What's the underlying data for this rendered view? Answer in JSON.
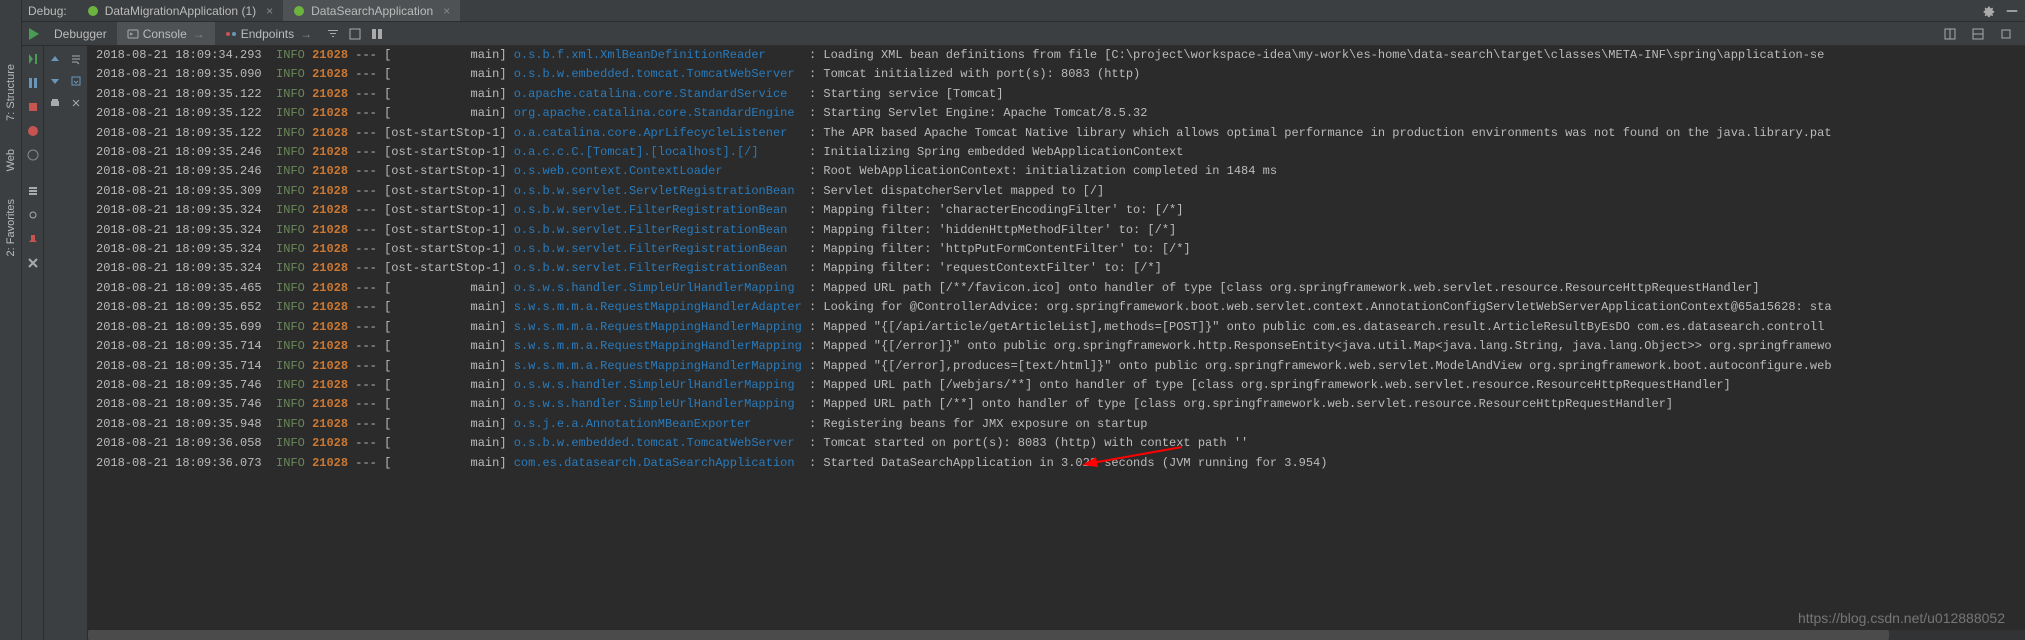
{
  "debug_label": "Debug:",
  "run_configs": [
    {
      "name": "DataMigrationApplication (1)",
      "active": false
    },
    {
      "name": "DataSearchApplication",
      "active": true
    }
  ],
  "tool_tabs": {
    "debugger": "Debugger",
    "console": "Console",
    "endpoints": "Endpoints"
  },
  "left_rail": {
    "structure": "7: Structure",
    "web": "Web",
    "favorites": "2: Favorites"
  },
  "watermark": "https://blog.csdn.net/u012888052",
  "log_columns": [
    "timestamp",
    "level",
    "pid",
    "marker",
    "thread",
    "logger",
    "message"
  ],
  "log_lines": [
    {
      "ts": "2018-08-21 18:09:34.293",
      "lvl": "INFO",
      "pid": "21028",
      "thr": "main",
      "logger": "o.s.b.f.xml.XmlBeanDefinitionReader",
      "msg": "Loading XML bean definitions from file [C:\\project\\workspace-idea\\my-work\\es-home\\data-search\\target\\classes\\META-INF\\spring\\application-se"
    },
    {
      "ts": "2018-08-21 18:09:35.090",
      "lvl": "INFO",
      "pid": "21028",
      "thr": "main",
      "logger": "o.s.b.w.embedded.tomcat.TomcatWebServer",
      "msg": "Tomcat initialized with port(s): 8083 (http)"
    },
    {
      "ts": "2018-08-21 18:09:35.122",
      "lvl": "INFO",
      "pid": "21028",
      "thr": "main",
      "logger": "o.apache.catalina.core.StandardService",
      "msg": "Starting service [Tomcat]"
    },
    {
      "ts": "2018-08-21 18:09:35.122",
      "lvl": "INFO",
      "pid": "21028",
      "thr": "main",
      "logger": "org.apache.catalina.core.StandardEngine",
      "msg": "Starting Servlet Engine: Apache Tomcat/8.5.32"
    },
    {
      "ts": "2018-08-21 18:09:35.122",
      "lvl": "INFO",
      "pid": "21028",
      "thr": "ost-startStop-1",
      "logger": "o.a.catalina.core.AprLifecycleListener",
      "msg": "The APR based Apache Tomcat Native library which allows optimal performance in production environments was not found on the java.library.pat"
    },
    {
      "ts": "2018-08-21 18:09:35.246",
      "lvl": "INFO",
      "pid": "21028",
      "thr": "ost-startStop-1",
      "logger": "o.a.c.c.C.[Tomcat].[localhost].[/]",
      "msg": "Initializing Spring embedded WebApplicationContext"
    },
    {
      "ts": "2018-08-21 18:09:35.246",
      "lvl": "INFO",
      "pid": "21028",
      "thr": "ost-startStop-1",
      "logger": "o.s.web.context.ContextLoader",
      "msg": "Root WebApplicationContext: initialization completed in 1484 ms"
    },
    {
      "ts": "2018-08-21 18:09:35.309",
      "lvl": "INFO",
      "pid": "21028",
      "thr": "ost-startStop-1",
      "logger": "o.s.b.w.servlet.ServletRegistrationBean",
      "msg": "Servlet dispatcherServlet mapped to [/]"
    },
    {
      "ts": "2018-08-21 18:09:35.324",
      "lvl": "INFO",
      "pid": "21028",
      "thr": "ost-startStop-1",
      "logger": "o.s.b.w.servlet.FilterRegistrationBean",
      "msg": "Mapping filter: 'characterEncodingFilter' to: [/*]"
    },
    {
      "ts": "2018-08-21 18:09:35.324",
      "lvl": "INFO",
      "pid": "21028",
      "thr": "ost-startStop-1",
      "logger": "o.s.b.w.servlet.FilterRegistrationBean",
      "msg": "Mapping filter: 'hiddenHttpMethodFilter' to: [/*]"
    },
    {
      "ts": "2018-08-21 18:09:35.324",
      "lvl": "INFO",
      "pid": "21028",
      "thr": "ost-startStop-1",
      "logger": "o.s.b.w.servlet.FilterRegistrationBean",
      "msg": "Mapping filter: 'httpPutFormContentFilter' to: [/*]"
    },
    {
      "ts": "2018-08-21 18:09:35.324",
      "lvl": "INFO",
      "pid": "21028",
      "thr": "ost-startStop-1",
      "logger": "o.s.b.w.servlet.FilterRegistrationBean",
      "msg": "Mapping filter: 'requestContextFilter' to: [/*]"
    },
    {
      "ts": "2018-08-21 18:09:35.465",
      "lvl": "INFO",
      "pid": "21028",
      "thr": "main",
      "logger": "o.s.w.s.handler.SimpleUrlHandlerMapping",
      "msg": "Mapped URL path [/**/favicon.ico] onto handler of type [class org.springframework.web.servlet.resource.ResourceHttpRequestHandler]"
    },
    {
      "ts": "2018-08-21 18:09:35.652",
      "lvl": "INFO",
      "pid": "21028",
      "thr": "main",
      "logger": "s.w.s.m.m.a.RequestMappingHandlerAdapter",
      "msg": "Looking for @ControllerAdvice: org.springframework.boot.web.servlet.context.AnnotationConfigServletWebServerApplicationContext@65a15628: sta"
    },
    {
      "ts": "2018-08-21 18:09:35.699",
      "lvl": "INFO",
      "pid": "21028",
      "thr": "main",
      "logger": "s.w.s.m.m.a.RequestMappingHandlerMapping",
      "msg": "Mapped \"{[/api/article/getArticleList],methods=[POST]}\" onto public com.es.datasearch.result.ArticleResultByEsDO com.es.datasearch.controll"
    },
    {
      "ts": "2018-08-21 18:09:35.714",
      "lvl": "INFO",
      "pid": "21028",
      "thr": "main",
      "logger": "s.w.s.m.m.a.RequestMappingHandlerMapping",
      "msg": "Mapped \"{[/error]}\" onto public org.springframework.http.ResponseEntity<java.util.Map<java.lang.String, java.lang.Object>> org.springframewo"
    },
    {
      "ts": "2018-08-21 18:09:35.714",
      "lvl": "INFO",
      "pid": "21028",
      "thr": "main",
      "logger": "s.w.s.m.m.a.RequestMappingHandlerMapping",
      "msg": "Mapped \"{[/error],produces=[text/html]}\" onto public org.springframework.web.servlet.ModelAndView org.springframework.boot.autoconfigure.web"
    },
    {
      "ts": "2018-08-21 18:09:35.746",
      "lvl": "INFO",
      "pid": "21028",
      "thr": "main",
      "logger": "o.s.w.s.handler.SimpleUrlHandlerMapping",
      "msg": "Mapped URL path [/webjars/**] onto handler of type [class org.springframework.web.servlet.resource.ResourceHttpRequestHandler]"
    },
    {
      "ts": "2018-08-21 18:09:35.746",
      "lvl": "INFO",
      "pid": "21028",
      "thr": "main",
      "logger": "o.s.w.s.handler.SimpleUrlHandlerMapping",
      "msg": "Mapped URL path [/**] onto handler of type [class org.springframework.web.servlet.resource.ResourceHttpRequestHandler]"
    },
    {
      "ts": "2018-08-21 18:09:35.948",
      "lvl": "INFO",
      "pid": "21028",
      "thr": "main",
      "logger": "o.s.j.e.a.AnnotationMBeanExporter",
      "msg": "Registering beans for JMX exposure on startup"
    },
    {
      "ts": "2018-08-21 18:09:36.058",
      "lvl": "INFO",
      "pid": "21028",
      "thr": "main",
      "logger": "o.s.b.w.embedded.tomcat.TomcatWebServer",
      "msg": "Tomcat started on port(s): 8083 (http) with context path ''"
    },
    {
      "ts": "2018-08-21 18:09:36.073",
      "lvl": "INFO",
      "pid": "21028",
      "thr": "main",
      "logger": "com.es.datasearch.DataSearchApplication",
      "msg": "Started DataSearchApplication in 3.028 seconds (JVM running for 3.954)"
    }
  ]
}
